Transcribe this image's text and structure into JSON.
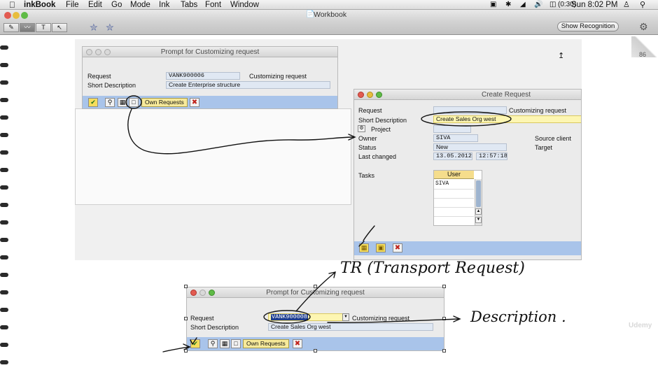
{
  "menubar": {
    "apple": "",
    "app": "inkBook",
    "items": [
      "File",
      "Edit",
      "Go",
      "Mode",
      "Ink",
      "Tabs",
      "Font",
      "Window"
    ],
    "battery": "(0:30)",
    "clock": "Sun 8:02 PM"
  },
  "window": {
    "title": "Workbook",
    "show_recognition": "Show Recognition",
    "page_num": "86",
    "tools": [
      "✎",
      "〰",
      "T",
      "↖"
    ]
  },
  "prompt1": {
    "title": "Prompt for Customizing request",
    "request_label": "Request",
    "request_value": "VANK900006",
    "request_side": "Customizing request",
    "short_desc_label": "Short Description",
    "short_desc_value": "Create Enterprise structure",
    "own_requests": "Own Requests"
  },
  "create": {
    "title": "Create Request",
    "request_label": "Request",
    "request_side": "Customizing request",
    "short_desc_label": "Short Description",
    "short_desc_value": "Create Sales Org west",
    "project_label": "Project",
    "owner_label": "Owner",
    "owner_value": "SIVA",
    "source_client": "Source client",
    "status_label": "Status",
    "status_value": "New",
    "target": "Target",
    "last_changed_label": "Last changed",
    "date_value": "13.05.2012",
    "time_value": "12:57:18",
    "tasks_label": "Tasks",
    "user_header": "User",
    "task_user": "SIVA"
  },
  "prompt2": {
    "title": "Prompt for Customizing request",
    "request_label": "Request",
    "request_value": "VANK900008",
    "request_side": "Customizing request",
    "short_desc_label": "Short Description",
    "short_desc_value": "Create Sales Org west",
    "own_requests": "Own Requests"
  },
  "annotations": {
    "tr": "TR (Transport Request)",
    "description": "Description ."
  },
  "watermark": "Udemy"
}
